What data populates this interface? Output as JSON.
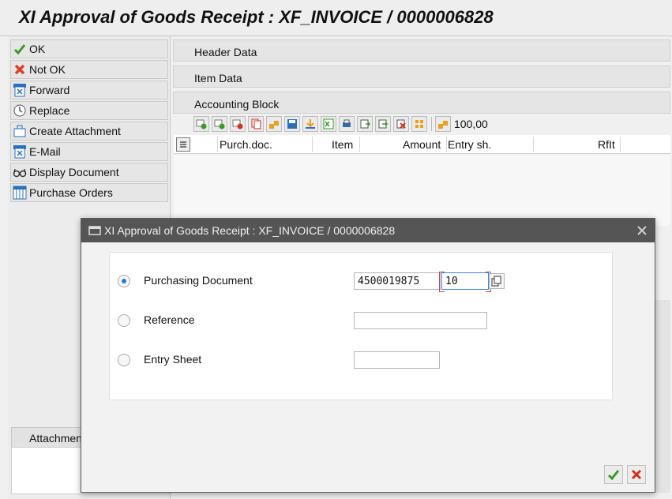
{
  "window": {
    "title": "XI Approval of Goods Receipt : XF_INVOICE / 0000006828"
  },
  "actions": [
    {
      "label": "OK",
      "icon": "checkmark-icon"
    },
    {
      "label": "Not OK",
      "icon": "red-x-icon"
    },
    {
      "label": "Forward",
      "icon": "forward-icon"
    },
    {
      "label": "Replace",
      "icon": "replace-icon"
    },
    {
      "label": "Create Attachment",
      "icon": "attachment-icon"
    },
    {
      "label": "E-Mail",
      "icon": "email-icon"
    },
    {
      "label": "Display Document",
      "icon": "glasses-icon"
    },
    {
      "label": "Purchase Orders",
      "icon": "purchase-orders-icon"
    }
  ],
  "sections": {
    "header_data": "Header Data",
    "item_data": "Item Data",
    "accounting_block": "Accounting Block"
  },
  "toolbar": {
    "sum_value": "100,00"
  },
  "grid": {
    "columns": [
      "Purch.doc.",
      "Item",
      "Amount",
      "Entry sh.",
      "RfIt"
    ]
  },
  "attachments": {
    "tab_label": "Attachments"
  },
  "dialog": {
    "title": "XI Approval of Goods Receipt : XF_INVOICE / 0000006828",
    "options": [
      {
        "label": "Purchasing Document",
        "selected": true
      },
      {
        "label": "Reference",
        "selected": false
      },
      {
        "label": "Entry Sheet",
        "selected": false
      }
    ],
    "purchasing_document_value": "4500019875",
    "item_value": "10",
    "reference_value": "",
    "entry_sheet_value": ""
  },
  "colors": {
    "accent": "#2a7fce",
    "ok_green": "#3a9a2a",
    "cancel_red": "#cc3322",
    "dialog_title_bg": "#555555"
  }
}
